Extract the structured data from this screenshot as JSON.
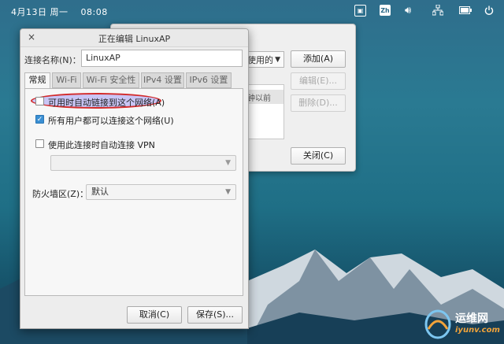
{
  "topbar": {
    "date": "4月13日",
    "weekday": "周一",
    "time": "08:08",
    "input_method": "Zh"
  },
  "back_window": {
    "combo_value": "使用的",
    "list_cell": "钟以前",
    "add_button": "添加(A)",
    "edit_button": "编辑(E)...",
    "delete_button": "删除(D)...",
    "close_button": "关闭(C)"
  },
  "dialog": {
    "title": "正在编辑 LinuxAP",
    "close_glyph": "×",
    "connection_name_label": "连接名称(N)：",
    "connection_name_value": "LinuxAP",
    "tabs": [
      {
        "label": "常规",
        "active": true
      },
      {
        "label": "Wi-Fi",
        "active": false
      },
      {
        "label": "Wi-Fi 安全性",
        "active": false
      },
      {
        "label": "IPv4 设置",
        "active": false
      },
      {
        "label": "IPv6 设置",
        "active": false
      }
    ],
    "general": {
      "auto_connect_label": "可用时自动链接到这个网络(A)",
      "auto_connect_checked": false,
      "all_users_label": "所有用户都可以连接这个网络(U)",
      "all_users_checked": true,
      "vpn_label": "使用此连接时自动连接 VPN",
      "vpn_checked": false,
      "vpn_select_value": "",
      "firewall_label": "防火墙区(Z)：",
      "firewall_value": "默认"
    },
    "cancel_button": "取消(C)",
    "save_button": "保存(S)..."
  },
  "watermark": {
    "name": "运维网",
    "site": "iyunv.com"
  },
  "colors": {
    "highlight_fill": "#c9c5f5",
    "highlight_ring": "#d32b2b",
    "checkbox_on": "#3a8fd3"
  }
}
